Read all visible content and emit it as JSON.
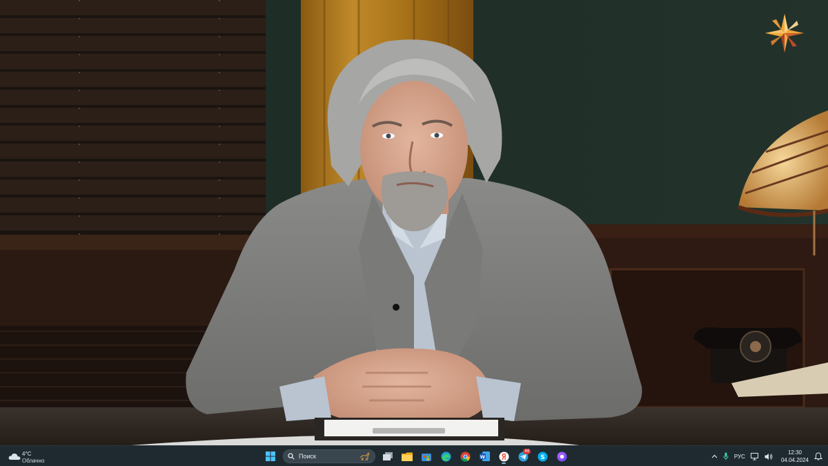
{
  "video": {
    "logo_icon": "star-compass-logo-icon"
  },
  "taskbar": {
    "weather": {
      "icon": "cloud-icon",
      "temperature": "4°C",
      "condition": "Облачно"
    },
    "search_placeholder": "Поиск",
    "apps": [
      {
        "name": "start-menu-icon"
      },
      {
        "name": "task-view-icon"
      },
      {
        "name": "file-explorer-icon"
      },
      {
        "name": "microsoft-store-icon"
      },
      {
        "name": "edge-icon"
      },
      {
        "name": "chrome-icon"
      },
      {
        "name": "word-icon"
      },
      {
        "name": "yandex-browser-icon"
      },
      {
        "name": "telegram-icon",
        "badge": "44"
      },
      {
        "name": "skype-icon"
      },
      {
        "name": "alice-icon"
      }
    ],
    "tray": {
      "language": "РУС",
      "time": "12:30",
      "date": "04.04.2024"
    }
  },
  "colors": {
    "taskbar_bg": "#1f2a30",
    "accent": "#8fb4c8"
  }
}
